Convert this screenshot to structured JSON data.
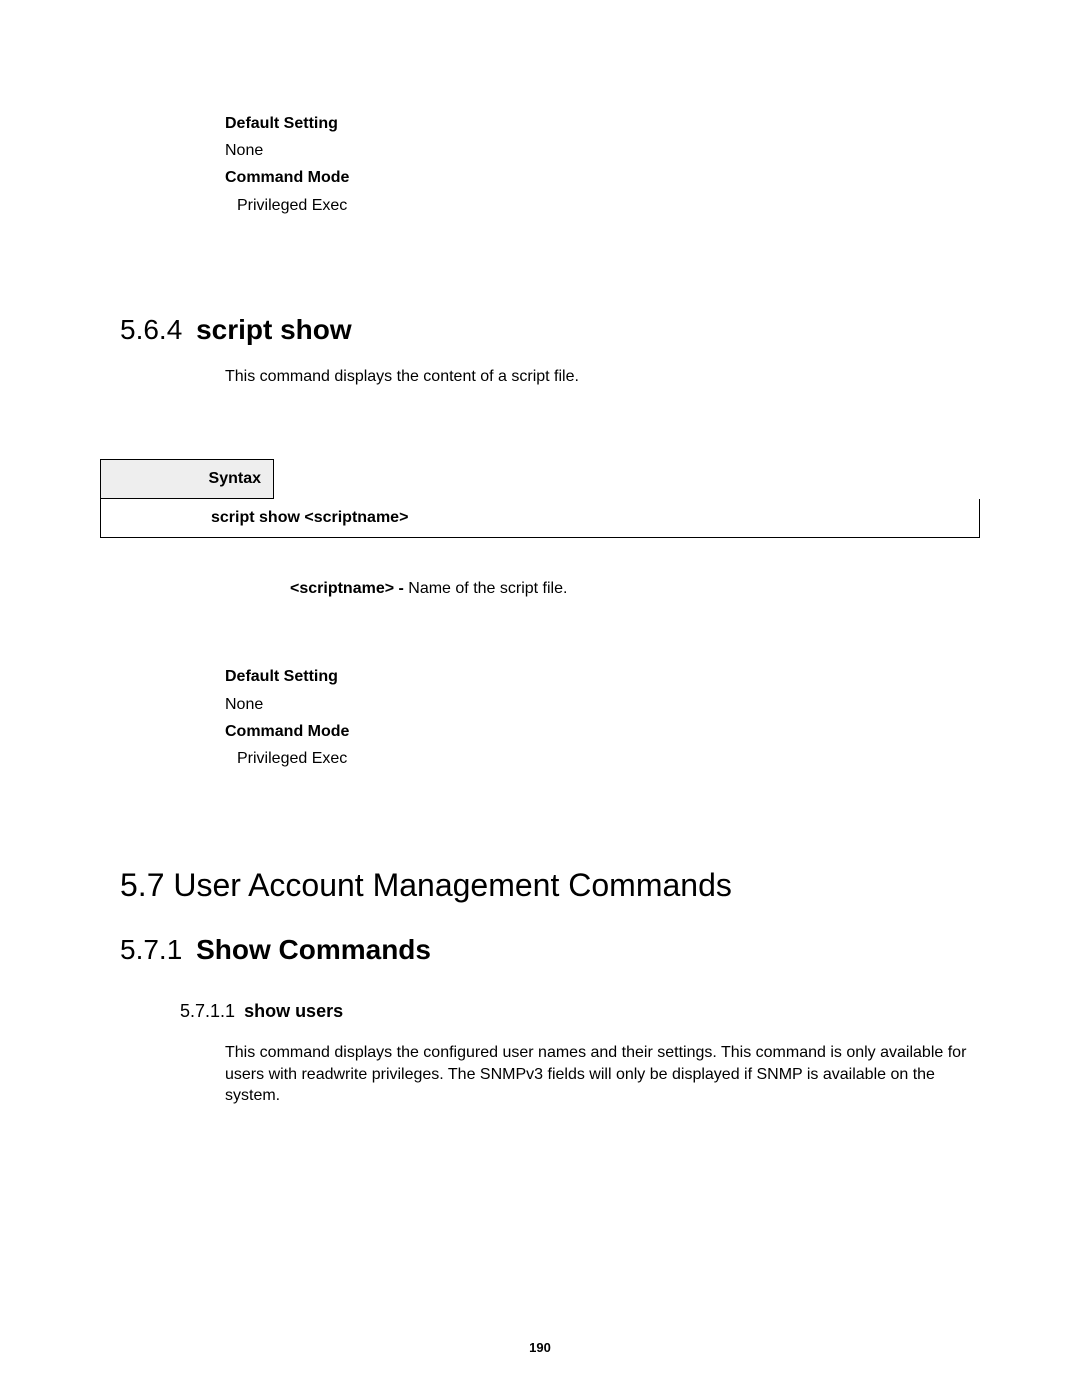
{
  "block1": {
    "defaultSettingLabel": "Default Setting",
    "defaultSettingValue": "None",
    "commandModeLabel": "Command Mode",
    "commandModeValue": "Privileged Exec"
  },
  "section564": {
    "number": "5.6.4",
    "title": "script show",
    "description": "This command displays the content of a script file.",
    "syntax": {
      "label": "Syntax",
      "command": "script show <scriptname>"
    },
    "param": {
      "name": "<scriptname> -",
      "desc": " Name of the script file."
    }
  },
  "block2": {
    "defaultSettingLabel": "Default Setting",
    "defaultSettingValue": "None",
    "commandModeLabel": "Command Mode",
    "commandModeValue": "Privileged Exec"
  },
  "section57": {
    "number": "5.7",
    "title": "User Account Management Commands"
  },
  "section571": {
    "number": "5.7.1",
    "title": "Show Commands"
  },
  "section5711": {
    "number": "5.7.1.1",
    "title": "show users",
    "description": "This command displays the configured user names and their settings. This command is only available for users with readwrite privileges. The SNMPv3 fields will only be displayed if SNMP is available on the system."
  },
  "pageNumber": "190"
}
